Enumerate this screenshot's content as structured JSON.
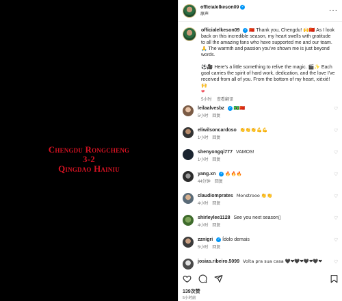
{
  "media": {
    "line1": "Chengdu Rongcheng",
    "line2": "3-2",
    "line3": "Qingdao Hainiu"
  },
  "header": {
    "username": "officialelkeson09",
    "subtitle": "原声",
    "more": "···"
  },
  "caption": {
    "username": "officialelkeson09",
    "flag": "🇨🇳",
    "p1": "Thank you, Chengdu! 🙌🇨🇳 As I look back on this incredible season, my heart swells with gratitude to all the amazing fans who have supported me and our team. 🙏 The warmth and passion you've shown me is just beyond words.",
    "p2": "⚽🎥 Here's a little something to relive the magic. 🎬✨ Each goal carries the spirit of hard work, dedication, and the love I've received from all of you. From the bottom of my heart, xièxiè! 🙌",
    "heart": "❤",
    "time": "5小时",
    "translate": "查看翻译"
  },
  "comments": [
    {
      "user": "leilaalvesbz",
      "verified": true,
      "text": "🇧🇷🇨🇳",
      "time": "5小时",
      "reply": "回复"
    },
    {
      "user": "eliwilsoncardoso",
      "verified": false,
      "text": "👏👏👏💪💪",
      "time": "1小时",
      "reply": "回复"
    },
    {
      "user": "shenyongqi777",
      "verified": false,
      "text": "VAMOS!",
      "time": "1小时",
      "reply": "回复"
    },
    {
      "user": "yang.xn",
      "verified": true,
      "text": "🔥🔥🔥",
      "time": "44分钟",
      "reply": "回复"
    },
    {
      "user": "claudiomprates",
      "verified": false,
      "text": "Monstrooo 👏👏",
      "time": "4小时",
      "reply": "回复"
    },
    {
      "user": "shirleylee1128",
      "verified": false,
      "text": "See you next season▯",
      "time": "4小时",
      "reply": "回复"
    },
    {
      "user": "zznigri",
      "verified": true,
      "text": "Ídolo demais",
      "time": "5小时",
      "reply": "回复"
    },
    {
      "user": "josias.ribeiro.5099",
      "verified": false,
      "text": "Volta pra sua casa 🖤❤🖤❤🖤❤🖤❤",
      "time": "",
      "reply": ""
    }
  ],
  "footer": {
    "likes": "139次赞",
    "time": "5小时前"
  },
  "colors": {
    "accent": "#0095f6",
    "score_red": "#d51222",
    "heart_red": "#ed4956"
  }
}
